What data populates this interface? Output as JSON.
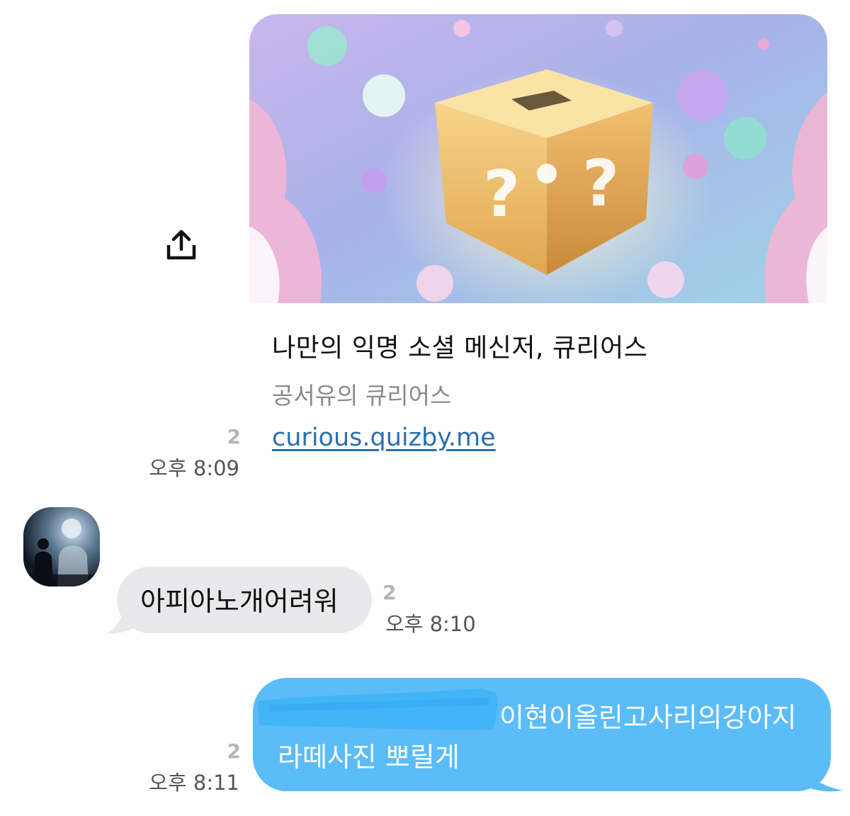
{
  "link_preview": {
    "title": "나만의 익명 소셜 메신저, 큐리어스",
    "subtitle": "공서유의 큐리어스",
    "url": "curious.quizby.me",
    "image_icon": "mystery-box-image",
    "read_count": "2",
    "time": "오후 8:09"
  },
  "share_icon": "share-upload-icon",
  "received_message": {
    "avatar_icon": "avatar-photo",
    "text": "아피아노개어려워",
    "read_count": "2",
    "time": "오후 8:10"
  },
  "sent_message": {
    "line1": "이현이올린고사리의강아지",
    "line2": "라떼사진 뽀릴게",
    "read_count": "2",
    "time": "오후 8:11"
  },
  "colors": {
    "sent_bubble": "#5bbcf8",
    "received_bubble": "#e9e9eb",
    "link": "#2a6fb0",
    "scribble": "#3fb2f7"
  }
}
